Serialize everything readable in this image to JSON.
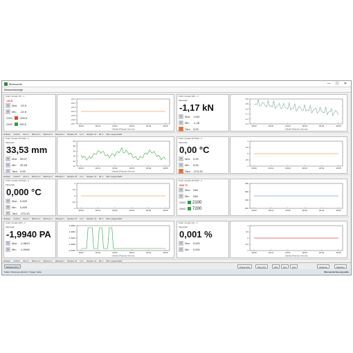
{
  "window": {
    "title": "Messwerte"
  },
  "tab": {
    "label": "Messwertanzeige"
  },
  "window_buttons": "—  ☐  ✕",
  "toolbar": [
    "Einfügen",
    "Anzahl ▾",
    "Zoom ▾",
    "Minimum ▾",
    "Maximum ▾",
    "Messwert ▾",
    "Samples: 25",
    "Lin ▾",
    "Samples: 10",
    "Eff: 4",
    "Filter: ausgeschaltet"
  ],
  "panels": [
    {
      "header": "Kraft / Ansatz (N) - 1",
      "unit_note": "-22,5",
      "value": "",
      "style": "small",
      "stats": [
        {
          "icon": "S",
          "label": "Max",
          "value": "-22,5"
        },
        {
          "icon": "S",
          "label": "Min",
          "value": "-22,5"
        }
      ],
      "limits": [
        {
          "label": "GW1",
          "color": "#e04040",
          "value": "-200,0"
        },
        {
          "label": "GW2",
          "color": "#2aa043",
          "value": "100,0"
        }
      ]
    },
    {
      "header": "Kraft / Ansatz (kN) - 2",
      "unit_note": "Massstab",
      "value": "-1,17 kN",
      "style": "big",
      "stats": [
        {
          "icon": "S",
          "label": "Max",
          "value": "-0,84"
        },
        {
          "icon": "S",
          "label": "Min",
          "value": "-1,28"
        },
        {
          "icon": "T",
          "label": "Tara",
          "value": "0,00"
        }
      ],
      "limits": []
    },
    {
      "header": "Kraft / Ansatz (PT100) - 1",
      "unit_note": "Massstab",
      "value": "33,53 mm",
      "style": "big",
      "stats": [
        {
          "icon": "S",
          "label": "Max",
          "value": "35,07"
        },
        {
          "icon": "S",
          "label": "Min",
          "value": "32,48"
        },
        {
          "icon": "T",
          "label": "Tara",
          "value": "0,00"
        }
      ],
      "limits": []
    },
    {
      "header": "Kraft / Ansatz (PT100) - 2",
      "unit_note": "Massstab",
      "value": "0,00 °C",
      "style": "big",
      "stats": [
        {
          "icon": "S",
          "label": "Max",
          "value": "0,00"
        },
        {
          "icon": "S",
          "label": "Min",
          "value": "0,00"
        },
        {
          "icon": "T",
          "label": "Tara",
          "value": "-273,15"
        }
      ],
      "limits": []
    },
    {
      "header": "Kraft / Ansatz (PT100) - 3",
      "unit_note": "Massstab",
      "value": "0,000 °C",
      "style": "big",
      "stats": [
        {
          "icon": "S",
          "label": "Max",
          "value": "0,000"
        },
        {
          "icon": "S",
          "label": "Min",
          "value": "0,000"
        },
        {
          "icon": "T",
          "label": "Tara",
          "value": "-273,15"
        }
      ],
      "limits": []
    },
    {
      "header": "Kraft / Ansatz (PT100) - 4",
      "unit_note": "348 °C",
      "value": "",
      "style": "small",
      "stats": [
        {
          "icon": "S",
          "label": "Max",
          "value": "348"
        },
        {
          "icon": "S",
          "label": "Min",
          "value": "348"
        }
      ],
      "limits": [
        {
          "label": "GW1",
          "color": "#2aa043",
          "value": "2100"
        },
        {
          "label": "GW2",
          "color": "#2aa043",
          "value": "7200"
        }
      ]
    },
    {
      "header": "Kraft / Ansatz (PA) - 1",
      "unit_note": "Massstab",
      "value": "-1,9940 PA",
      "style": "big",
      "stats": [
        {
          "icon": "S",
          "label": "Max",
          "value": "-1,9819"
        },
        {
          "icon": "S",
          "label": "Min",
          "value": "-1,9948"
        }
      ],
      "limits": []
    },
    {
      "header": "Kraft / Ansatz (%) - 1",
      "unit_note": "Massstab",
      "value": "0,001 %",
      "style": "big",
      "stats": [
        {
          "icon": "S",
          "label": "Max",
          "value": "0,001"
        },
        {
          "icon": "S",
          "label": "Min",
          "value": "0,001"
        }
      ],
      "limits": []
    }
  ],
  "plots": [
    {
      "ylabels": [
        "-22.1",
        "-22.2",
        "-22.3",
        "-22.4",
        "-22.5",
        "-22.6",
        "-22.7"
      ],
      "xlabels": [
        "18:00",
        "18:01",
        "18:02",
        "18:03",
        "18:04",
        "18:05"
      ],
      "xtitle": "Uhrzeit (Format: hh:mm)",
      "series_color": "#f0a060",
      "kind": "flat"
    },
    {
      "ylabels": [
        "-0.8",
        "-0.9",
        "-1.0",
        "-1.1",
        "-1.2",
        "-1.3"
      ],
      "xlabels": [
        "18:00",
        "18:01",
        "18:02",
        "18:03",
        "18:04",
        "18:05"
      ],
      "xtitle": "Uhrzeit (Format: hh:mm)",
      "series_color": "#7fa6a0",
      "kind": "noisy"
    },
    {
      "ylabels": [
        "36",
        "35",
        "34",
        "33",
        "32",
        "31"
      ],
      "xlabels": [
        "18:00",
        "18:01",
        "18:02",
        "18:03",
        "18:04",
        "18:05"
      ],
      "xtitle": "Uhrzeit (Format: hh:mm)",
      "series_color": "#3da83a",
      "kind": "wave"
    },
    {
      "ylabels": [
        "1",
        "0.5",
        "0",
        "-0.5",
        "-1"
      ],
      "xlabels": [
        "18:00",
        "18:01",
        "18:02",
        "18:03",
        "18:04",
        "18:05"
      ],
      "xtitle": "",
      "series_color": "#f0a060",
      "kind": "flat"
    },
    {
      "ylabels": [
        "1",
        "0.5",
        "0",
        "-0.5",
        "-1"
      ],
      "xlabels": [
        "18:00",
        "18:01",
        "18:02",
        "18:03",
        "18:04",
        "18:05"
      ],
      "xtitle": "",
      "series_color": "#f0a060",
      "kind": "flat"
    },
    {
      "ylabels": [
        "400",
        "350",
        "300",
        "250"
      ],
      "xlabels": [
        "18:00",
        "18:01",
        "18:02",
        "18:03",
        "18:04",
        "18:05"
      ],
      "xtitle": "",
      "series_color": "#6aa5d8",
      "kind": "flat"
    },
    {
      "ylabels": [
        "-1.9800",
        "-1.9850",
        "-1.9900",
        "-1.9950",
        "-2.0000"
      ],
      "xlabels": [
        "18:00",
        "18:01",
        "18:02",
        "18:03",
        "18:04",
        "18:05"
      ],
      "xtitle": "Uhrzeit (Format: hh:mm)",
      "series_color": "#2aa043",
      "kind": "spikes"
    },
    {
      "ylabels": [
        "1",
        "0.5",
        "0",
        "-0.5",
        "-1"
      ],
      "xlabels": [
        "18:00",
        "18:01",
        "18:02",
        "18:03",
        "18:04",
        "18:05"
      ],
      "xtitle": "Uhrzeit (Format: hh:mm)",
      "series_color": "#e04040",
      "kind": "flat"
    }
  ],
  "bottombar": {
    "left_button": "Einlesen (F1)",
    "buttons": [
      "Power (F6)",
      "Tara (F7)",
      "F10",
      "F11",
      "F12",
      "Optionen",
      "Speicher"
    ]
  },
  "status": {
    "left": "Status: Messung aktiviert  |  Trigger: Ende",
    "right": "Messwerterfassung aktiv"
  }
}
